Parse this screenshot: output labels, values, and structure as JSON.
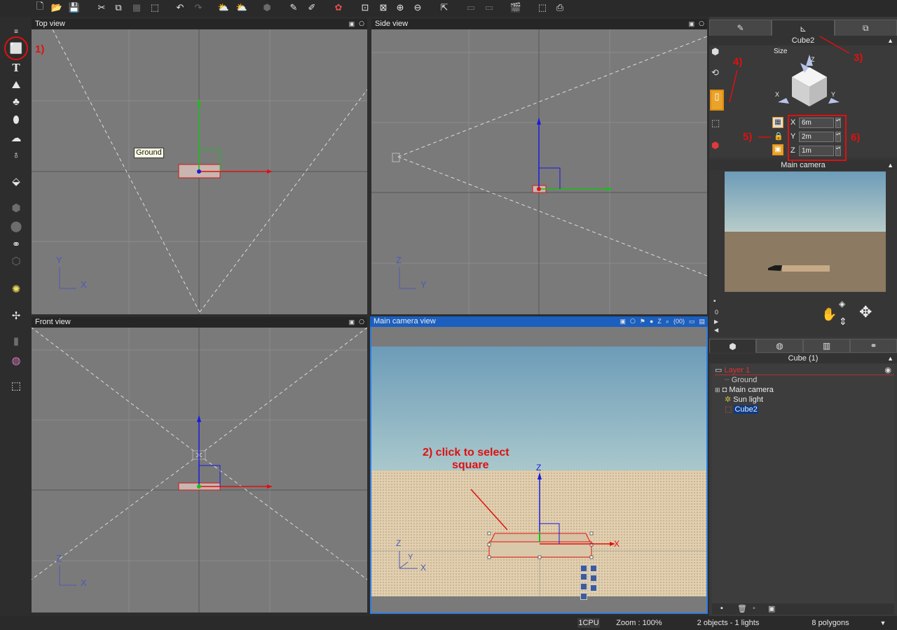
{
  "toolbar": {
    "icons": [
      "new-file-icon",
      "open-file-icon",
      "save-icon",
      "cut-icon",
      "copy-icon",
      "paste-icon",
      "duplicate-icon",
      "undo-icon",
      "redo-icon",
      "weather-icon",
      "weather-alt-icon",
      "render-object-icon",
      "paint-icon",
      "paint-alt-icon",
      "color-palette-icon",
      "zoom-region-icon",
      "zoom-fit-icon",
      "zoom-in-icon",
      "zoom-out-icon",
      "camera-export-icon",
      "film-strip-icon",
      "film-strip-alt-icon",
      "clapper-icon",
      "select-box-icon",
      "render-icon"
    ]
  },
  "left_tools": [
    "cube-icon",
    "text-icon",
    "terrain-icon",
    "tree-icon",
    "rock-icon",
    "cloud-icon",
    "planet-icon",
    "import-object-icon",
    "boolean-icon",
    "metablob-icon",
    "link-icon",
    "modifier-icon",
    "light-icon",
    "fan-icon",
    "bar-chart-icon",
    "globe-icon",
    "object-export-icon"
  ],
  "viewports": {
    "top": {
      "title": "Top view",
      "axis_v": "Y",
      "axis_h": "X",
      "tooltip": "Ground"
    },
    "side": {
      "title": "Side view",
      "axis_v": "Z",
      "axis_h": "Y"
    },
    "front": {
      "title": "Front view",
      "axis_v": "Z",
      "axis_h": "X"
    },
    "camera": {
      "title": "Main camera view",
      "axis_v": "Z",
      "axis_h": "X",
      "axis_d": "Y",
      "gizmo_z": "Z",
      "gizmo_x": "X",
      "toolbar_z": "Z",
      "toolbar_zoom": "(00)"
    }
  },
  "annotations": {
    "a1": "1)",
    "a2_line1": "2) click to select",
    "a2_line2": "square",
    "a3": "3)",
    "a4": "4)",
    "a5": "5)",
    "a6": "6)"
  },
  "properties": {
    "object_name": "Cube2",
    "size_label": "Size",
    "gizmo_z": "Z",
    "gizmo_x": "X",
    "gizmo_y": "Y",
    "fields": [
      {
        "axis": "X",
        "value": "6m"
      },
      {
        "axis": "Y",
        "value": "2m"
      },
      {
        "axis": "Z",
        "value": "1m"
      }
    ]
  },
  "preview": {
    "title": "Main camera",
    "counter": "0"
  },
  "scene": {
    "title": "Cube (1)",
    "items": [
      {
        "label": "Layer 1"
      },
      {
        "label": "Ground"
      },
      {
        "label": "Main camera"
      },
      {
        "label": "Sun light"
      },
      {
        "label": "Cube2"
      }
    ]
  },
  "status": {
    "cpu": "1CPU",
    "zoom": "Zoom : 100%",
    "objects": "2 objects - 1 lights",
    "polygons": "8 polygons"
  },
  "colors": {
    "viewport_bg": "#7a7a7a",
    "active_header": "#1b5fbf",
    "annotation": "#e01010",
    "selection": "#0a3a8a"
  }
}
